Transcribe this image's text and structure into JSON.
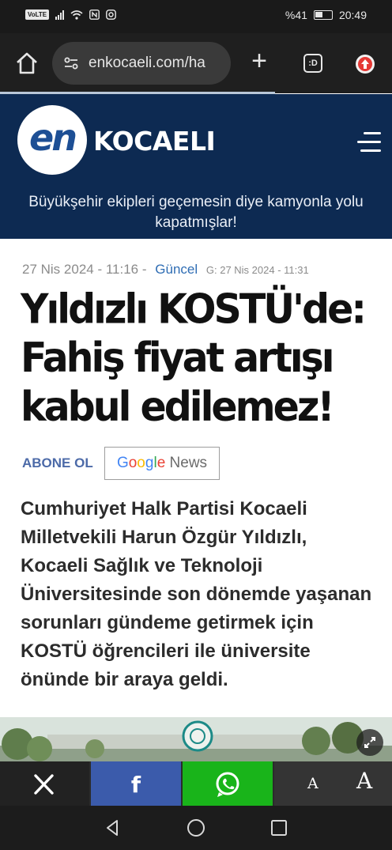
{
  "status_bar": {
    "volte": "VoLTE",
    "battery": "%41",
    "time": "20:49"
  },
  "browser": {
    "url": "enkocaeli.com/ha"
  },
  "site": {
    "logo_mark": "en",
    "logo_name": "KOCAELI",
    "ticker_text": "Büyükşehir ekipleri geçemesin diye kamyonla yolu kapatmışlar!"
  },
  "article": {
    "published": "27 Nis 2024 - 11:16",
    "separator": "-",
    "category": "Güncel",
    "updated": "G: 27 Nis 2024 - 11:31",
    "headline": "Yıldızlı KOSTÜ'de: Fahiş fiyat artışı kabul edilemez!",
    "subscribe_label": "ABONE OL",
    "google_news": {
      "letters": [
        "G",
        "o",
        "o",
        "g",
        "l",
        "e"
      ],
      "suffix": "News"
    },
    "summary": "Cumhuriyet Halk Partisi Kocaeli Milletvekili Harun Özgür Yıldızlı, Kocaeli Sağlık ve Teknoloji Üniversitesinde son dönemde yaşanan sorunları gündeme getirmek için KOSTÜ öğrencileri ile üniversite önünde bir araya geldi."
  },
  "share_bar": {
    "font_small": "A",
    "font_large": "A",
    "x_label": "X",
    "facebook_label": "f"
  },
  "colors": {
    "header_bg": "#0d2a52",
    "category": "#2f6db4",
    "facebook": "#3b5bab",
    "whatsapp": "#19b41a"
  },
  "icons": [
    "home-icon",
    "site-settings-icon",
    "plus-icon",
    "tabs-icon",
    "update-icon",
    "hamburger-menu-icon",
    "expand-icon",
    "x-icon",
    "facebook-icon",
    "whatsapp-icon",
    "back-icon",
    "home-circle-icon",
    "recents-icon"
  ]
}
